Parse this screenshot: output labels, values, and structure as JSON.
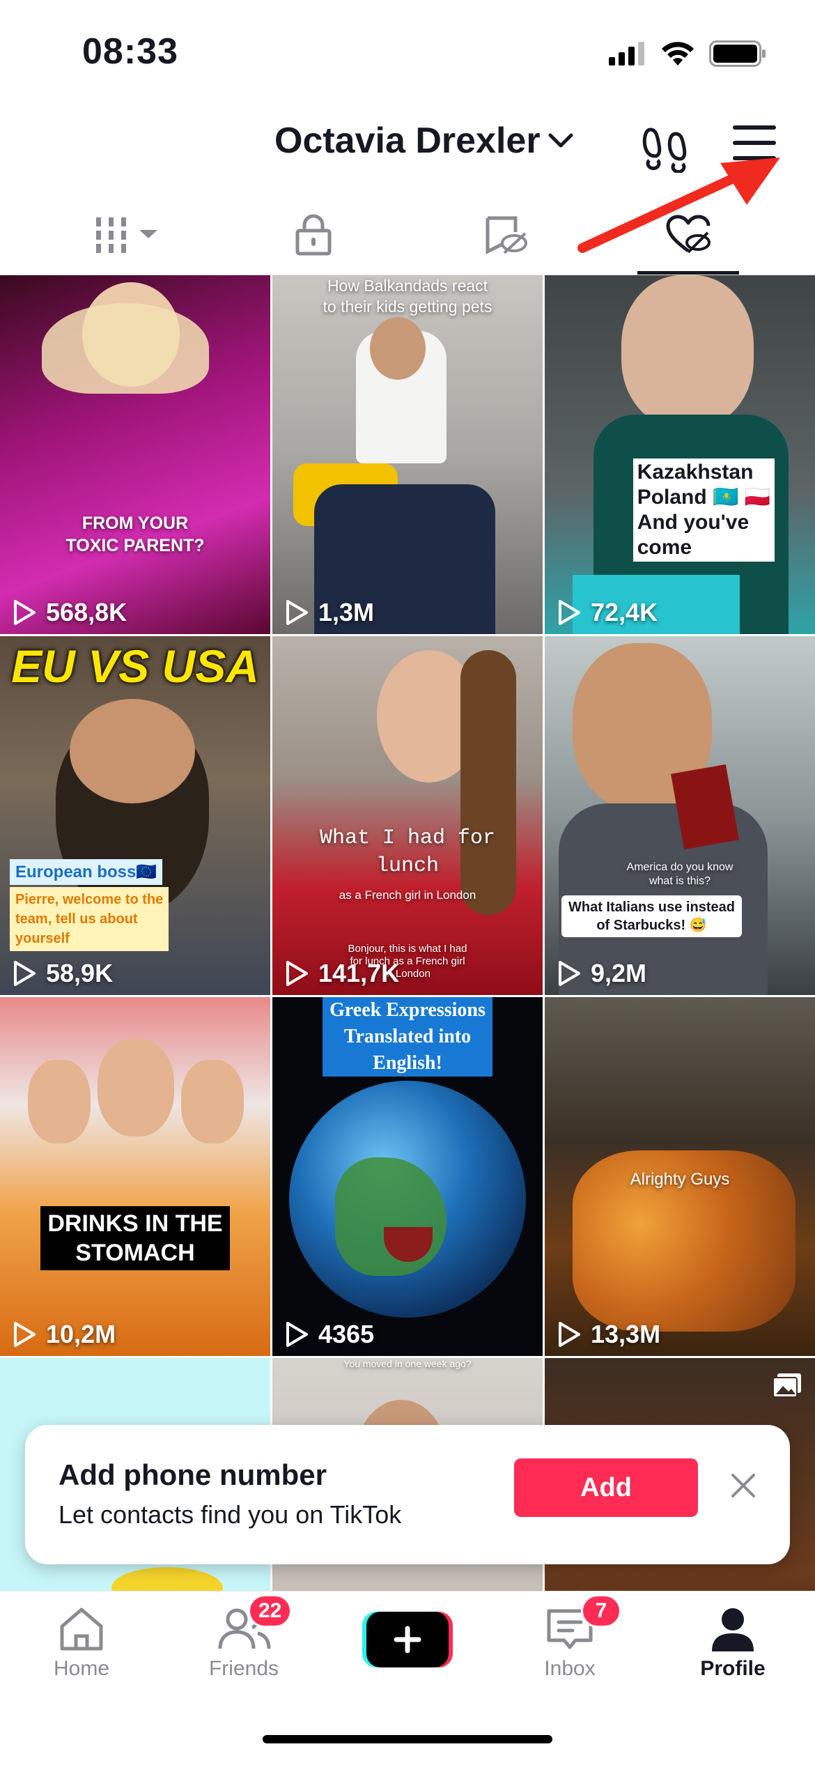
{
  "status_bar": {
    "time": "08:33"
  },
  "header": {
    "profile_name": "Octavia Drexler"
  },
  "tabs": [
    {
      "name": "videos",
      "icon": "grid-icon"
    },
    {
      "name": "private",
      "icon": "lock-icon"
    },
    {
      "name": "reposts",
      "icon": "hidden-repost-icon"
    },
    {
      "name": "liked",
      "icon": "hidden-heart-icon",
      "active": true
    }
  ],
  "videos": [
    {
      "caption": "FROM YOUR\nTOXIC PARENT?",
      "views": "568,8K"
    },
    {
      "caption": "How Balkandads react\nto their kids getting pets",
      "views": "1,3M"
    },
    {
      "caption": "Kazakhstan\nPoland 🇰🇿 🇵🇱\nAnd you've\ncome",
      "views": "72,4K"
    },
    {
      "caption": "EU VS USA",
      "subcaption_1": "European boss🇪🇺",
      "subcaption_2": "Pierre, welcome to the\nteam, tell us about\nyourself",
      "views": "58,9K"
    },
    {
      "caption": "What I had for\nlunch",
      "subcaption_1": "as a French girl in London",
      "subcaption_2": "Bonjour, this is what I had\nfor lunch as a French girl\nin London",
      "views": "141,7K"
    },
    {
      "caption": "What Italians use instead\nof Starbucks! 😅",
      "subcaption_1": "America do you know\nwhat is this?",
      "views": "9,2M"
    },
    {
      "caption": "DRINKS IN THE\nSTOMACH",
      "views": "10,2M"
    },
    {
      "caption": "Greek Expressions\nTranslated into\nEnglish!",
      "views": "4365"
    },
    {
      "caption": "Alrighty Guys",
      "views": "13,3M"
    },
    {
      "caption": "",
      "views": ""
    },
    {
      "caption": "You moved in one week ago?",
      "views": ""
    },
    {
      "caption": "",
      "views": ""
    }
  ],
  "banner": {
    "title": "Add phone number",
    "subtitle": "Let contacts find you on TikTok",
    "add_label": "Add"
  },
  "nav": {
    "home": "Home",
    "friends": "Friends",
    "friends_badge": "22",
    "inbox": "Inbox",
    "inbox_badge": "7",
    "profile": "Profile"
  },
  "colors": {
    "accent": "#fe2c55",
    "create_cyan": "#25f4ee",
    "arrow": "#f02a1f"
  }
}
